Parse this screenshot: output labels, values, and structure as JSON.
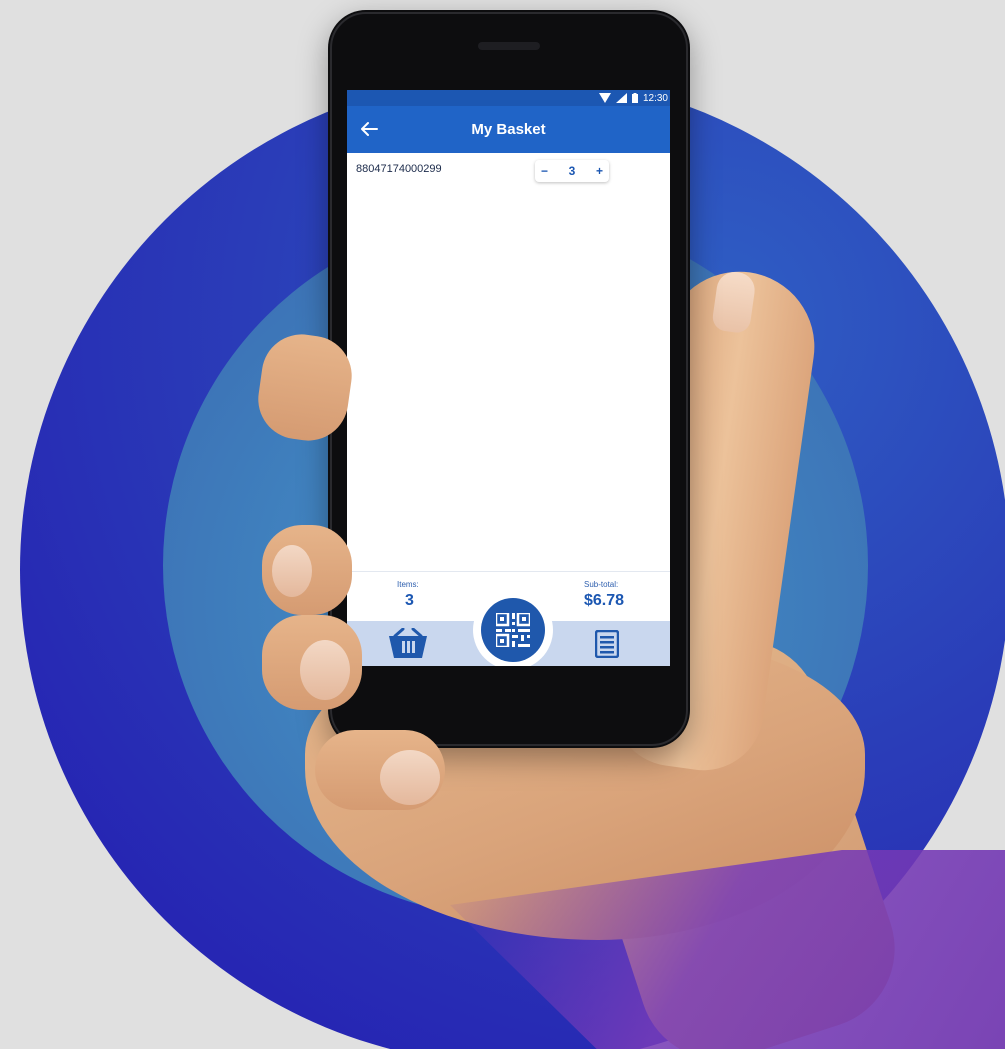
{
  "status_bar": {
    "time": "12:30"
  },
  "app_bar": {
    "title": "My Basket"
  },
  "basket": {
    "items": [
      {
        "barcode": "88047174000299",
        "quantity": "3",
        "minus_label": "−",
        "plus_label": "+"
      }
    ]
  },
  "summary": {
    "items_label": "Items:",
    "items_value": "3",
    "subtotal_label": "Sub-total:",
    "subtotal_value": "$6.78"
  },
  "nav": {
    "left_icon": "basket-icon",
    "center_icon": "qr-code-icon",
    "right_icon": "list-icon"
  },
  "colors": {
    "app_bar": "#2064c7",
    "status_bar": "#1c57b2",
    "accent": "#1c57b2",
    "nav_bg": "#c9d7ee"
  }
}
